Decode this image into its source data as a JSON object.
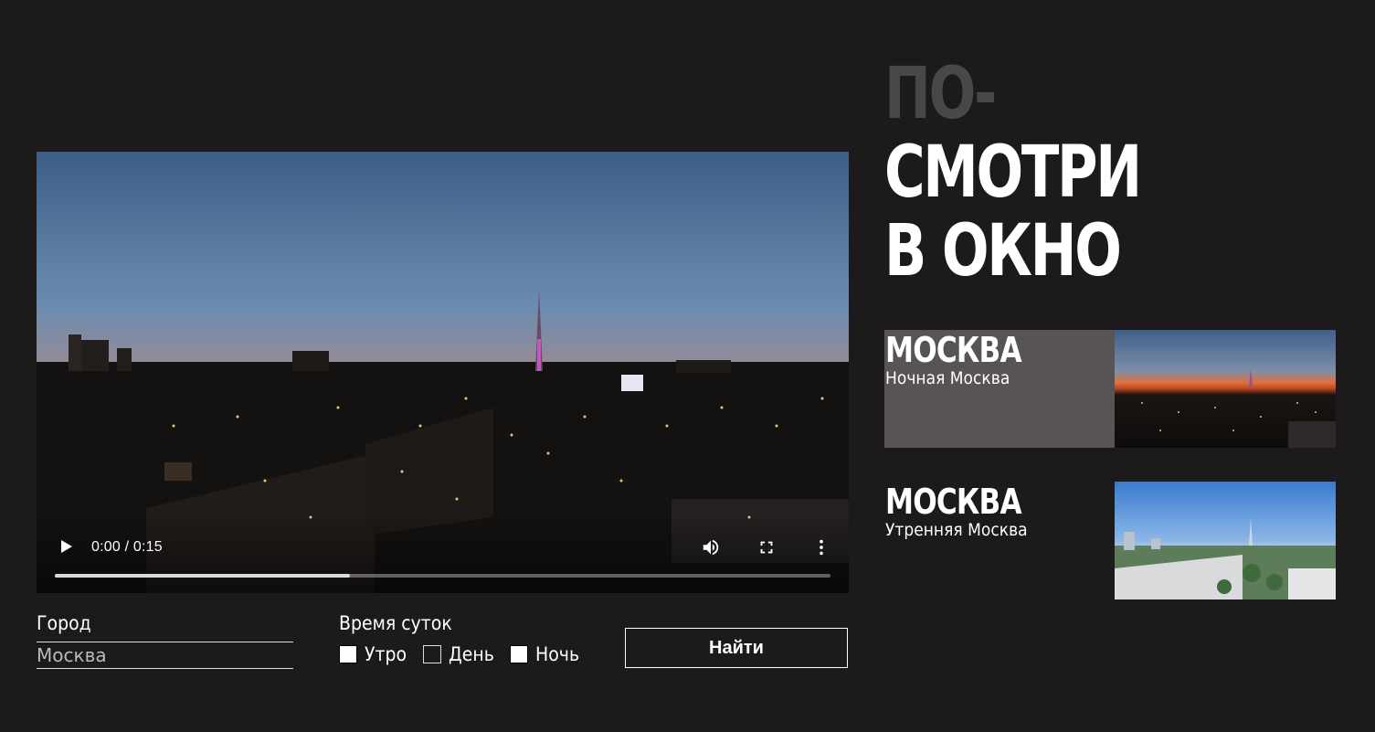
{
  "title": {
    "line1": "ПО-",
    "line2": "СМОТРИ",
    "line3": "В ОКНО"
  },
  "video": {
    "time": "0:00 / 0:15",
    "progress": 0.38,
    "icons": [
      "play-icon",
      "volume-icon",
      "fullscreen-icon",
      "more-options-icon"
    ]
  },
  "cards": [
    {
      "city": "МОСКВА",
      "subtitle": "Ночная Москва"
    },
    {
      "city": "МОСКВА",
      "subtitle": "Утренняя Москва"
    }
  ],
  "form": {
    "city_label": "Город",
    "city_value": "Москва",
    "time_label": "Время суток",
    "options": [
      {
        "label": "Утро",
        "checked": false
      },
      {
        "label": "День",
        "checked": false
      },
      {
        "label": "Ночь",
        "checked": false
      }
    ],
    "search_button": "Найти"
  },
  "colors": {
    "background": "#1c1a1b",
    "title_gray": "#4a4747",
    "active_card": "#585455"
  }
}
